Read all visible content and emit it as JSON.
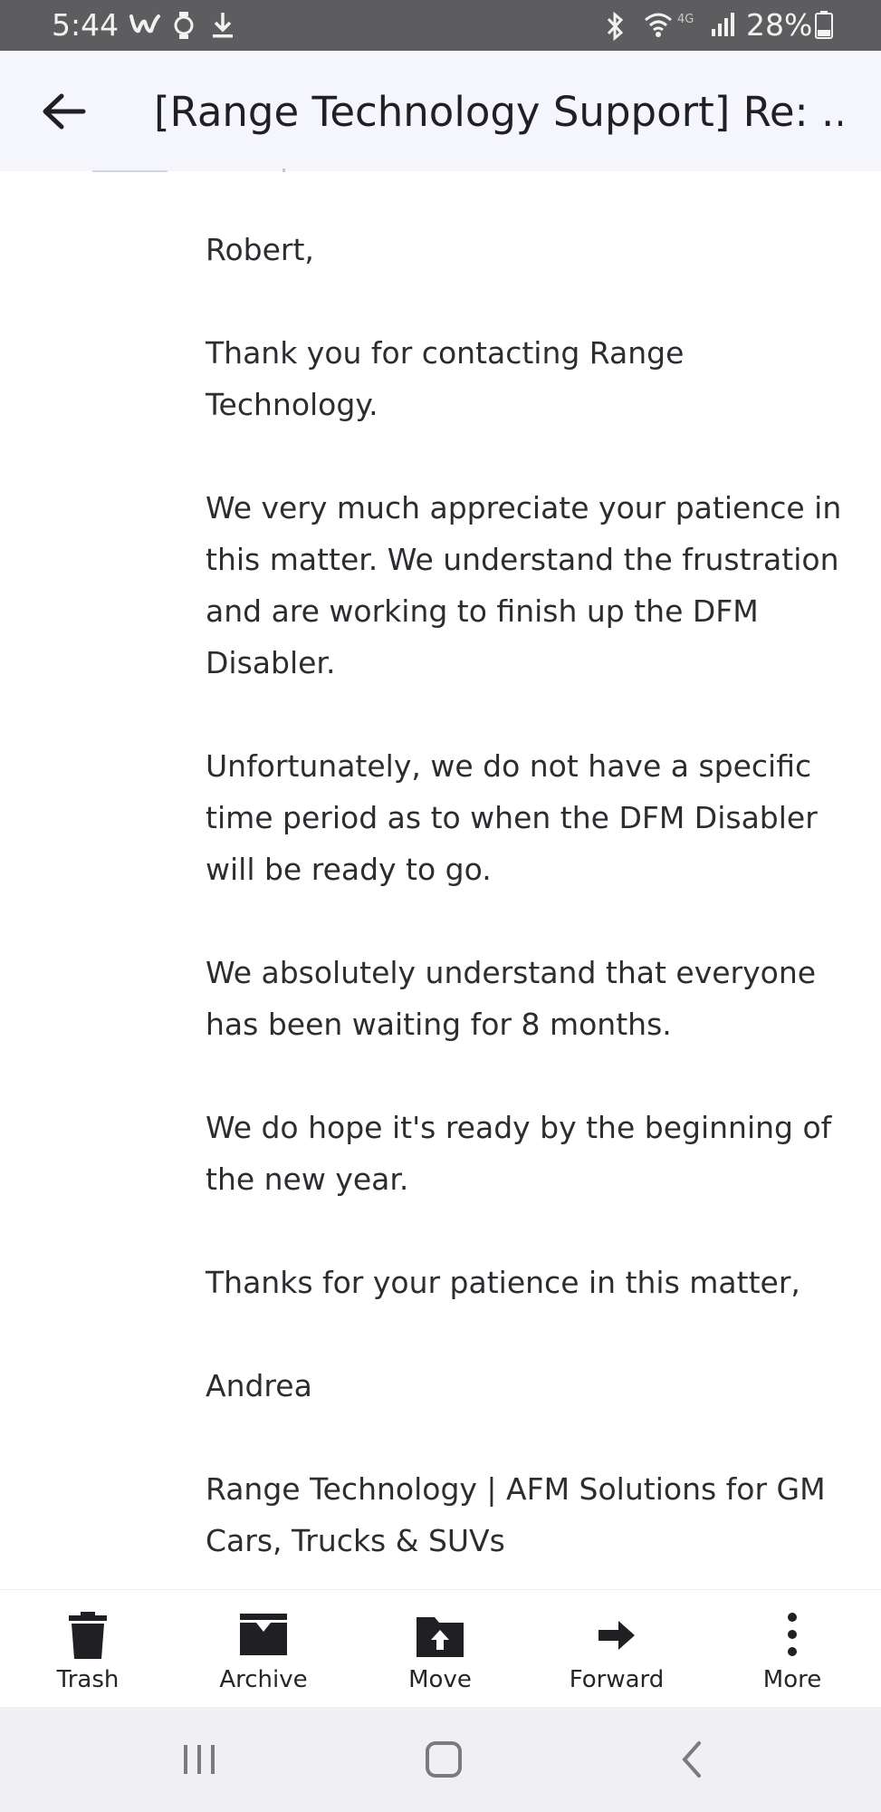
{
  "status_bar": {
    "time": "5:44",
    "battery_percent": "28%",
    "left_icons": [
      "w-app-icon",
      "watch-icon",
      "download-icon"
    ],
    "right_icons": [
      "bluetooth-icon",
      "wifi-icon",
      "4g-signal-icon",
      "battery-icon"
    ]
  },
  "header": {
    "subject": "[Range Technology Support] Re: ..."
  },
  "message": {
    "paragraphs": [
      "Robert,",
      "Thank you for contacting Range Technology.",
      "We very much appreciate your patience in this matter.  We understand the frustration and are working to finish up the DFM Disabler.",
      "Unfortunately, we do not have a specific time period as to when the DFM Disabler will be ready to go.",
      "We absolutely understand that everyone has been waiting for 8 months.",
      "We do hope it's ready by the beginning of the new year.",
      "Thanks for your patience in this matter,",
      "Andrea",
      "Range Technology | AFM Solutions for GM Cars, Trucks & SUVs"
    ]
  },
  "toolbar": {
    "trash": "Trash",
    "archive": "Archive",
    "move": "Move",
    "forward": "Forward",
    "more": "More"
  },
  "colors": {
    "status_bar_bg": "#5d5d60",
    "header_bg": "#f5f5fc",
    "text": "#2c2c31",
    "nav_bar_bg": "#f0f0f2"
  }
}
